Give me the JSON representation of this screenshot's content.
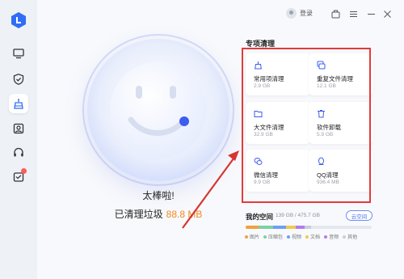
{
  "header": {
    "login_label": "登录"
  },
  "sidebar": {
    "items": [
      {
        "icon": "monitor-icon"
      },
      {
        "icon": "shield-check-icon"
      },
      {
        "icon": "broom-icon",
        "active": true
      },
      {
        "icon": "toolbox-icon"
      },
      {
        "icon": "headset-icon"
      },
      {
        "icon": "message-icon",
        "badge": true
      }
    ]
  },
  "status": {
    "title": "太棒啦!",
    "cleaned_label": "已清理垃圾",
    "cleaned_amount": "88.8 MB"
  },
  "special_clean": {
    "title": "专项清理",
    "cards": [
      {
        "name": "常用项清理",
        "size": "2.9 GB",
        "icon": "broom-icon"
      },
      {
        "name": "重复文件清理",
        "size": "12.1 GB",
        "icon": "duplicate-files-icon"
      },
      {
        "name": "大文件清理",
        "size": "32.9 GB",
        "icon": "folder-icon"
      },
      {
        "name": "软件卸载",
        "size": "5.9 GB",
        "icon": "trash-icon"
      },
      {
        "name": "微信清理",
        "size": "9.9 GB",
        "icon": "wechat-icon"
      },
      {
        "name": "QQ清理",
        "size": "936.4 MB",
        "icon": "qq-icon"
      }
    ]
  },
  "space": {
    "title": "我的空间",
    "usage": "139 GB / 475.7 GB",
    "cloud_button": "云空间",
    "segments": [
      {
        "label": "图片",
        "color": "#f0a13c",
        "fraction": 0.1
      },
      {
        "label": "压缩包",
        "color": "#7bd1a2",
        "fraction": 0.12
      },
      {
        "label": "视频",
        "color": "#6aa0f5",
        "fraction": 0.1
      },
      {
        "label": "文档",
        "color": "#f2c94c",
        "fraction": 0.08
      },
      {
        "label": "音频",
        "color": "#b07cf0",
        "fraction": 0.07
      },
      {
        "label": "其他",
        "color": "#c9ced8",
        "fraction": 0.05
      }
    ]
  },
  "colors": {
    "accent": "#4b6ef0",
    "amount": "#f08a24",
    "highlight_frame": "#e23b3b"
  }
}
